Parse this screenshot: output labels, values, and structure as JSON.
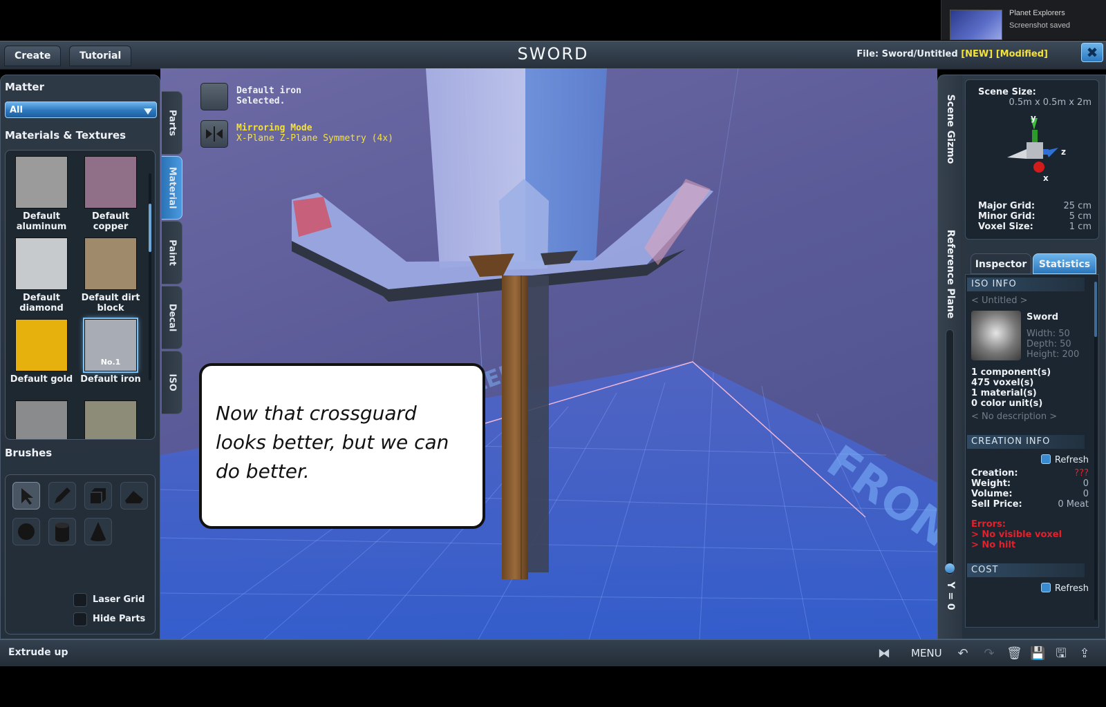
{
  "notification": {
    "app": "Planet Explorers",
    "message": "Screenshot saved"
  },
  "topbar": {
    "tabs": [
      "Create",
      "Tutorial"
    ],
    "title": "SWORD",
    "file_label": "File:",
    "file_name": "Sword/Untitled",
    "tag_new": "[NEW]",
    "tag_modified": "[Modified]",
    "close": "✖"
  },
  "left": {
    "matter_title": "Matter",
    "matter_selected": "All",
    "materials_title": "Materials & Textures",
    "materials": [
      {
        "label": "Default aluminum",
        "color": "#9b9b9b"
      },
      {
        "label": "Default copper",
        "color": "#8f7088"
      },
      {
        "label": "Default diamond",
        "color": "#c7cacd"
      },
      {
        "label": "Default dirt block",
        "color": "#a08a6c"
      },
      {
        "label": "Default gold",
        "color": "#e6b00d"
      },
      {
        "label": "Default iron",
        "color": "#a8adb5",
        "badge": "No.1",
        "selected": true
      },
      {
        "label": "",
        "color": "#8a8b8d"
      },
      {
        "label": "",
        "color": "#8d8c78"
      }
    ],
    "brushes_title": "Brushes",
    "brushes": [
      "select-tool",
      "pencil-tool",
      "box-tool",
      "slope-tool",
      "sphere-tool",
      "cylinder-tool",
      "cone-tool"
    ],
    "checkboxes": [
      {
        "label": "Laser Grid"
      },
      {
        "label": "Hide Parts"
      }
    ]
  },
  "vtabs": [
    "Parts",
    "Material",
    "Paint",
    "Decal",
    "ISO"
  ],
  "overlay": {
    "material_name": "Default iron",
    "material_status": "Selected.",
    "mirror_title": "Mirroring Mode",
    "mirror_detail": "X-Plane Z-Plane Symmetry (4x)"
  },
  "bubble": {
    "text": "Now that crossguard looks better, but we can do better."
  },
  "right": {
    "tab_scene": "Scene Gizmo",
    "tab_ref": "Reference Plane",
    "ref_value": "Y = 0",
    "scene_size_label": "Scene Size:",
    "scene_size": "0.5m x 0.5m x 2m",
    "axes": {
      "y": "y",
      "z": "z",
      "x": "x"
    },
    "major_grid_label": "Major Grid:",
    "major_grid": "25 cm",
    "minor_grid_label": "Minor Grid:",
    "minor_grid": "5 cm",
    "voxel_size_label": "Voxel Size:",
    "voxel_size": "1 cm",
    "tabs": [
      "Inspector",
      "Statistics"
    ],
    "iso_info": "ISO INFO",
    "untitled": "< Untitled >",
    "iso_name": "Sword",
    "width": "Width: 50",
    "depth": "Depth: 50",
    "height": "Height: 200",
    "counts": [
      "1 component(s)",
      "475 voxel(s)",
      "1 material(s)",
      "0 color unit(s)"
    ],
    "no_desc": "< No description >",
    "creation_info": "CREATION INFO",
    "refresh": "Refresh",
    "creation_label": "Creation:",
    "creation_value": "???",
    "weight_label": "Weight:",
    "weight_value": "0",
    "volume_label": "Volume:",
    "volume_value": "0",
    "price_label": "Sell Price:",
    "price_value": "0 Meat",
    "errors_title": "Errors:",
    "errors": [
      "> No visible voxel",
      "> No hilt"
    ],
    "cost": "COST"
  },
  "statusbar": {
    "message": "Extrude up",
    "menu": "MENU"
  },
  "scene_text": {
    "front": "FRONT",
    "left": "LEFT"
  }
}
